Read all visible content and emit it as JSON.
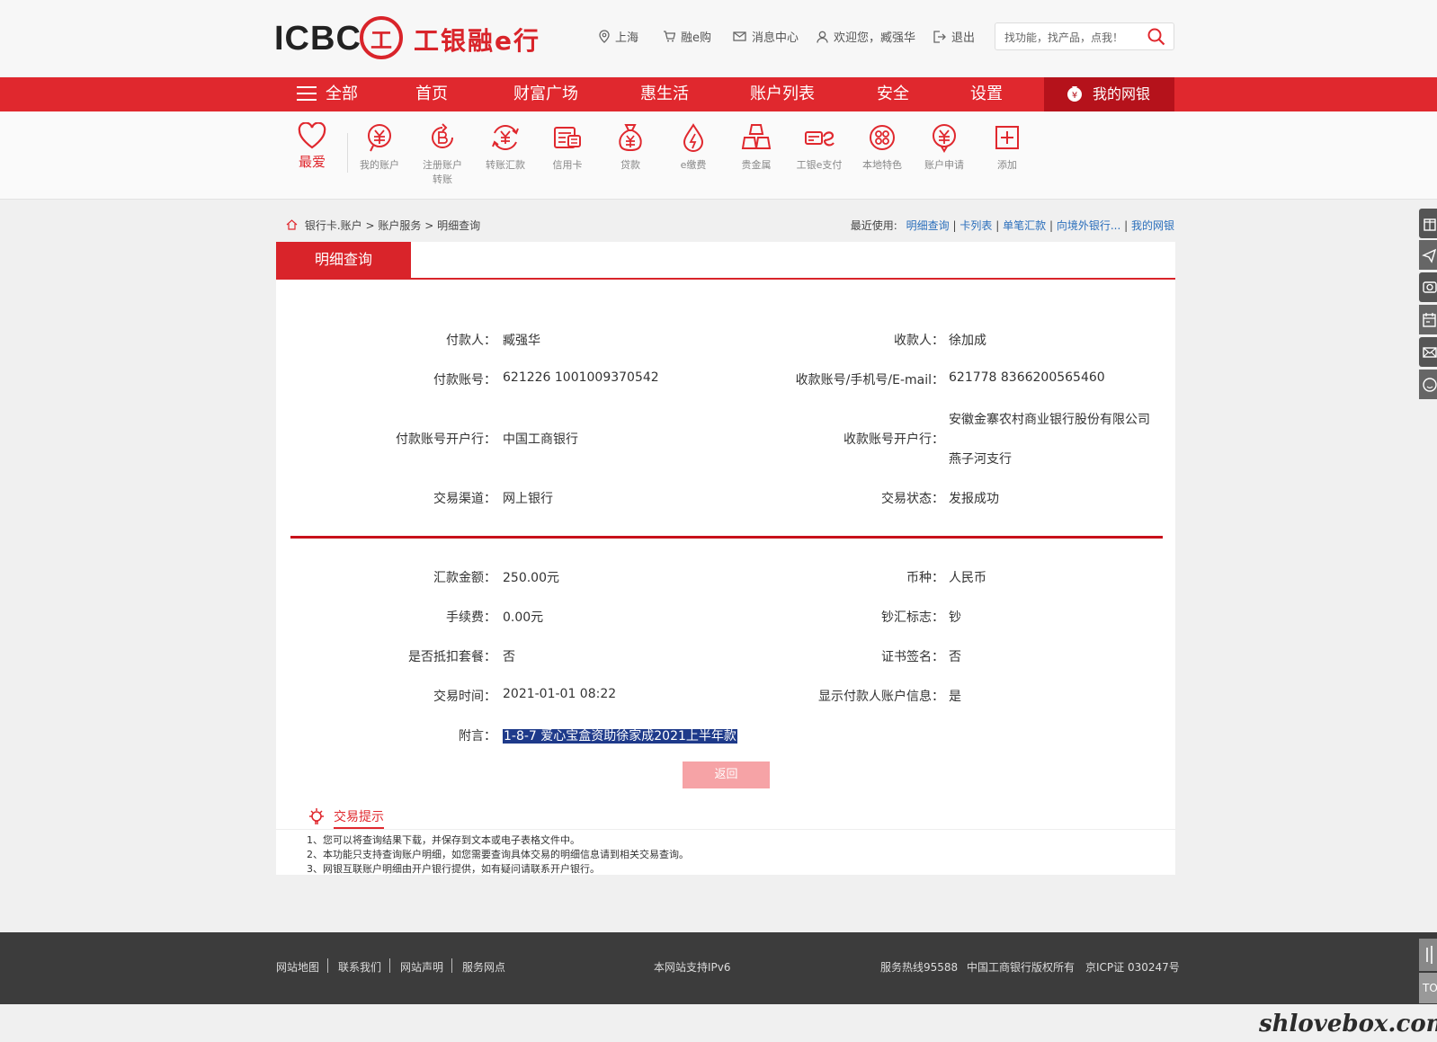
{
  "header": {
    "logo_latin": "ICBC",
    "logo_seal": "工",
    "logo_cn": "工银融e行",
    "links": {
      "city": "上海",
      "shop": "融e购",
      "messages": "消息中心",
      "welcome": "欢迎您，臧强华",
      "logout": "退出"
    },
    "search_placeholder": "找功能，找产品，点我！"
  },
  "nav": {
    "all": "全部",
    "home": "首页",
    "wealth": "财富广场",
    "life": "惠生活",
    "accounts": "账户列表",
    "security": "安全",
    "settings": "设置",
    "mybank": "我的网银"
  },
  "shortcuts": {
    "favorite": "最爱",
    "items": [
      {
        "label1": "我的账户",
        "label2": "",
        "icon": "yuan-circle-icon"
      },
      {
        "label1": "注册账户",
        "label2": "转账",
        "icon": "refresh-b-icon"
      },
      {
        "label1": "转账汇款",
        "label2": "",
        "icon": "yuan-arrows-icon"
      },
      {
        "label1": "信用卡",
        "label2": "",
        "icon": "credit-card-icon"
      },
      {
        "label1": "贷款",
        "label2": "",
        "icon": "money-bag-icon"
      },
      {
        "label1": "e缴费",
        "label2": "",
        "icon": "drop-lightning-icon"
      },
      {
        "label1": "贵金属",
        "label2": "",
        "icon": "gold-bars-icon"
      },
      {
        "label1": "工银e支付",
        "label2": "",
        "icon": "epay-icon"
      },
      {
        "label1": "本地特色",
        "label2": "",
        "icon": "local-icon"
      },
      {
        "label1": "账户申请",
        "label2": "",
        "icon": "yuan-pin-icon"
      },
      {
        "label1": "添加",
        "label2": "",
        "icon": "plus-square-icon"
      }
    ]
  },
  "breadcrumb": {
    "a": "银行卡.账户",
    "b": "账户服务",
    "c": "明细查询",
    "sep": ">"
  },
  "recent": {
    "label": "最近使用:",
    "links": [
      "明细查询",
      "卡列表",
      "单笔汇款",
      "向境外银行...",
      "我的网银"
    ],
    "sep": "|"
  },
  "tab_title": "明细查询",
  "details": {
    "payer_label": "付款人：",
    "payer": "臧强华",
    "payee_label": "收款人：",
    "payee": "徐加成",
    "payer_acct_label": "付款账号：",
    "payer_acct": "621226 1001009370542",
    "payee_acct_label": "收款账号/手机号/E-mail：",
    "payee_acct": "621778 8366200565460",
    "payer_bank_label": "付款账号开户行：",
    "payer_bank": "中国工商银行",
    "payee_bank_label": "收款账号开户行：",
    "payee_bank1": "安徽金寨农村商业银行股份有限公司",
    "payee_bank2": "燕子河支行",
    "channel_label": "交易渠道：",
    "channel": "网上银行",
    "status_label": "交易状态：",
    "status": "发报成功",
    "amount_label": "汇款金额：",
    "amount": "250.00元",
    "currency_label": "币种：",
    "currency": "人民币",
    "fee_label": "手续费：",
    "fee": "0.00元",
    "cash_label": "钞汇标志：",
    "cash": "钞",
    "package_label": "是否抵扣套餐：",
    "package": "否",
    "cert_label": "证书签名：",
    "cert": "否",
    "time_label": "交易时间：",
    "time": "2021-01-01 08:22",
    "show_payer_label": "显示付款人账户信息：",
    "show_payer": "是",
    "note_label": "附言：",
    "note": "1-8-7 爱心宝盒资助徐家成2021上半年款"
  },
  "back_button": "返回",
  "tips": {
    "title": "交易提示",
    "lines": [
      "1、您可以将查询结果下载，并保存到文本或电子表格文件中。",
      "2、本功能只支持查询账户明细，如您需要查询具体交易的明细信息请到相关交易查询。",
      "3、网银互联账户明细由开户银行提供，如有疑问请联系开户银行。"
    ]
  },
  "footer": {
    "links": [
      "网站地图",
      "联系我们",
      "网站声明",
      "服务网点"
    ],
    "ipv6": "本网站支持IPv6",
    "hotline": "服务热线95588",
    "copyright": "中国工商银行版权所有",
    "icp": "京ICP证 030247号"
  },
  "side_bottom": "TO",
  "watermark": "shlovebox.com",
  "colors": {
    "brand_red": "#e0282e",
    "dark_red": "#b5121b",
    "link_blue": "#2a6ebb"
  }
}
